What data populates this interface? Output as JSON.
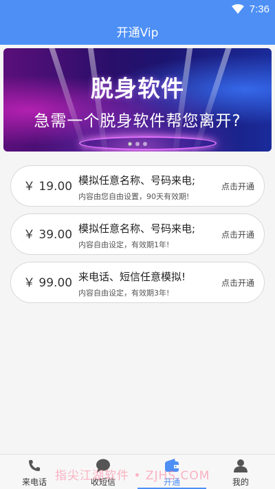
{
  "status": {
    "time": "7:36"
  },
  "app": {
    "title": "开通Vip"
  },
  "banner": {
    "headline": "脱身软件",
    "subline": "急需一个脱身软件帮您离开?",
    "active_slide": 1,
    "slide_count": 3
  },
  "plans": [
    {
      "price": "￥ 19.00",
      "name": "模拟任意名称、号码来电;",
      "desc": "内容由您自由设置，90天有效期!",
      "action": "点击开通"
    },
    {
      "price": "￥ 39.00",
      "name": "模拟任意名称、号码来电;",
      "desc": "内容自由设定，有效期1年!",
      "action": "点击开通"
    },
    {
      "price": "￥ 99.00",
      "name": "来电话、短信任意模拟!",
      "desc": "内容自由设定，有效期3年!",
      "action": "点击开通"
    }
  ],
  "nav": {
    "items": [
      {
        "label": "来电话",
        "icon": "phone-icon"
      },
      {
        "label": "收短信",
        "icon": "chat-bubble-icon"
      },
      {
        "label": "开通",
        "icon": "wallet-icon"
      },
      {
        "label": "我的",
        "icon": "person-icon"
      }
    ],
    "active_index": 2
  },
  "watermark": "指尖江湖软件 • ZJHS.COM",
  "colors": {
    "primary": "#4d8ff5",
    "background": "#f5f5f5"
  }
}
